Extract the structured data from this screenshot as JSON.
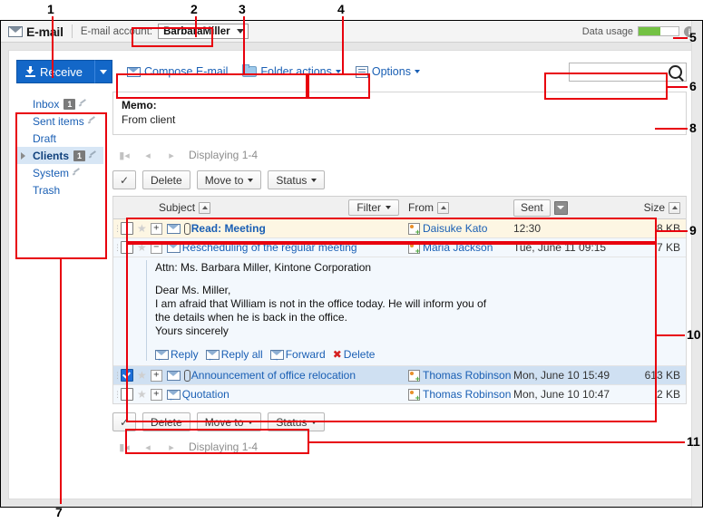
{
  "window": {
    "app_title": "E-mail",
    "app_icon": "envelope-icon",
    "account_label": "E-mail account:",
    "account_value": "BarbaraMiller",
    "usage_label": "Data usage",
    "usage_percent": 55,
    "info_icon": "info-icon"
  },
  "toolbar": {
    "receive_label": "Receive",
    "compose_label": "Compose E-mail",
    "folder_actions_label": "Folder actions",
    "options_label": "Options",
    "search_value": "",
    "search_placeholder": ""
  },
  "sidebar": {
    "items": [
      {
        "label": "Inbox",
        "badge": "1",
        "selected": false,
        "expander": false,
        "pen": true
      },
      {
        "label": "Sent items",
        "badge": "",
        "selected": false,
        "expander": false,
        "pen": true
      },
      {
        "label": "Draft",
        "badge": "",
        "selected": false,
        "expander": false,
        "pen": false
      },
      {
        "label": "Clients",
        "badge": "1",
        "selected": true,
        "expander": true,
        "pen": true
      },
      {
        "label": "System",
        "badge": "",
        "selected": false,
        "expander": false,
        "pen": true
      },
      {
        "label": "Trash",
        "badge": "",
        "selected": false,
        "expander": false,
        "pen": false
      }
    ]
  },
  "memo": {
    "title": "Memo:",
    "body": "From client"
  },
  "pager_top": {
    "text": "Displaying 1-4"
  },
  "pager_bottom": {
    "text": "Displaying 1-4"
  },
  "action_bar": {
    "select_all_icon": "checkmark-icon",
    "delete_label": "Delete",
    "move_to_label": "Move to",
    "status_label": "Status"
  },
  "list_header": {
    "subject": "Subject",
    "filter": "Filter",
    "from": "From",
    "sent": "Sent",
    "size": "Size"
  },
  "messages": [
    {
      "checked": false,
      "starred": false,
      "expander": "+",
      "attachment": true,
      "replied": false,
      "unread": true,
      "selected": false,
      "subject": "Read: Meeting",
      "from": "Daisuke Kato",
      "sent": "12:30",
      "size": "8 KB"
    },
    {
      "checked": false,
      "starred": false,
      "expander": "−",
      "attachment": false,
      "replied": false,
      "unread": false,
      "selected": false,
      "subject": "Rescheduling of the regular meeting",
      "from": "Maria Jackson",
      "sent": "Tue, June 11 09:15",
      "size": "7 KB"
    },
    {
      "checked": true,
      "starred": false,
      "expander": "+",
      "attachment": true,
      "replied": false,
      "unread": false,
      "selected": true,
      "subject": "Announcement of office relocation",
      "from": "Thomas Robinson",
      "sent": "Mon, June 10 15:49",
      "size": "613 KB"
    },
    {
      "checked": false,
      "starred": false,
      "expander": "+",
      "attachment": false,
      "replied": true,
      "unread": false,
      "selected": false,
      "subject": "Quotation",
      "from": "Thomas Robinson",
      "sent": "Mon, June 10 10:47",
      "size": "2 KB"
    }
  ],
  "preview": {
    "attn": "Attn: Ms. Barbara Miller, Kintone Corporation",
    "line1": "Dear Ms. Miller,",
    "line2": "I am afraid that William is not in the office today. He will inform you of",
    "line3": "the details when he is back in the office.",
    "line4": "Yours sincerely",
    "reply_label": "Reply",
    "reply_all_label": "Reply all",
    "forward_label": "Forward",
    "delete_label": "Delete"
  },
  "callouts": [
    {
      "n": "1"
    },
    {
      "n": "2"
    },
    {
      "n": "3"
    },
    {
      "n": "4"
    },
    {
      "n": "5"
    },
    {
      "n": "6"
    },
    {
      "n": "7"
    },
    {
      "n": "8"
    },
    {
      "n": "9"
    },
    {
      "n": "10"
    },
    {
      "n": "11"
    }
  ]
}
